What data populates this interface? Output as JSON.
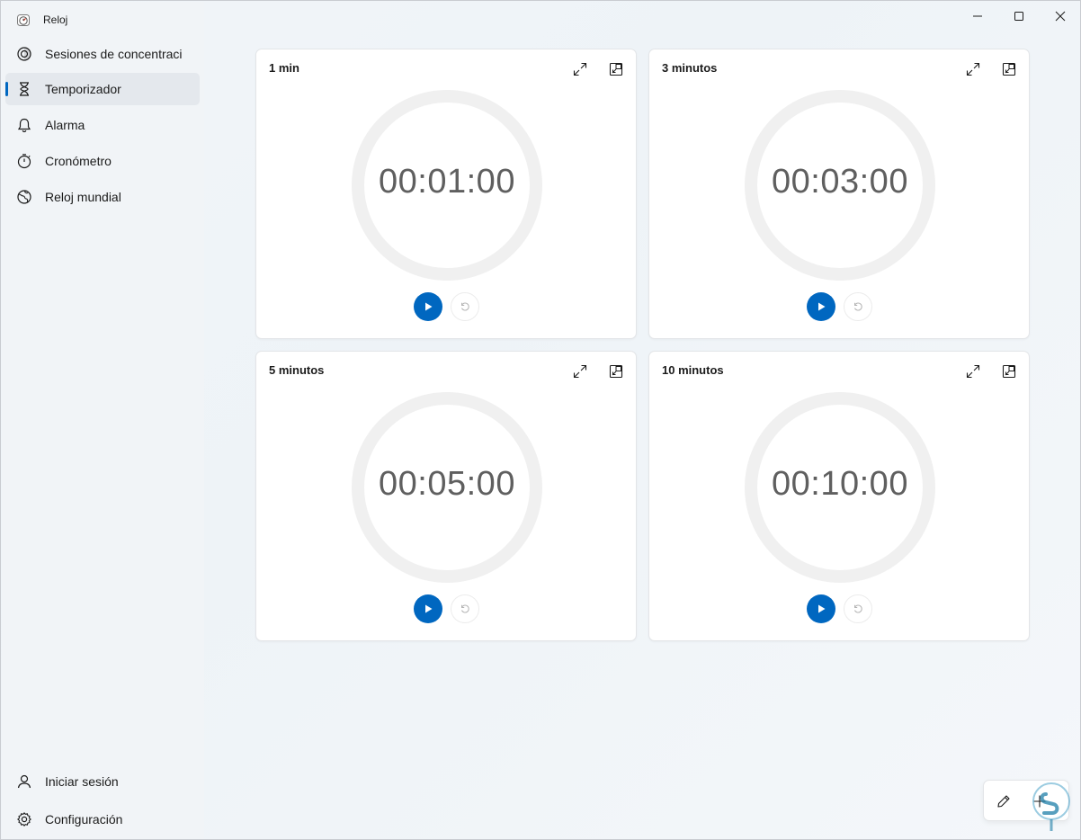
{
  "app": {
    "title": "Reloj"
  },
  "sidebar": {
    "items": [
      {
        "label": "Sesiones de concentración",
        "icon": "focus-icon"
      },
      {
        "label": "Temporizador",
        "icon": "hourglass-icon",
        "active": true
      },
      {
        "label": "Alarma",
        "icon": "bell-icon"
      },
      {
        "label": "Cronómetro",
        "icon": "stopwatch-icon"
      },
      {
        "label": "Reloj mundial",
        "icon": "globe-icon"
      }
    ],
    "bottom": [
      {
        "label": "Iniciar sesión",
        "icon": "person-icon"
      },
      {
        "label": "Configuración",
        "icon": "gear-icon"
      }
    ]
  },
  "timers": [
    {
      "title": "1 min",
      "time": "00:01:00"
    },
    {
      "title": "3 minutos",
      "time": "00:03:00"
    },
    {
      "title": "5 minutos",
      "time": "00:05:00"
    },
    {
      "title": "10 minutos",
      "time": "00:10:00"
    }
  ],
  "colors": {
    "accent": "#0067c0",
    "ring": "#f0f0f0",
    "time_text": "#5f5f5f"
  }
}
